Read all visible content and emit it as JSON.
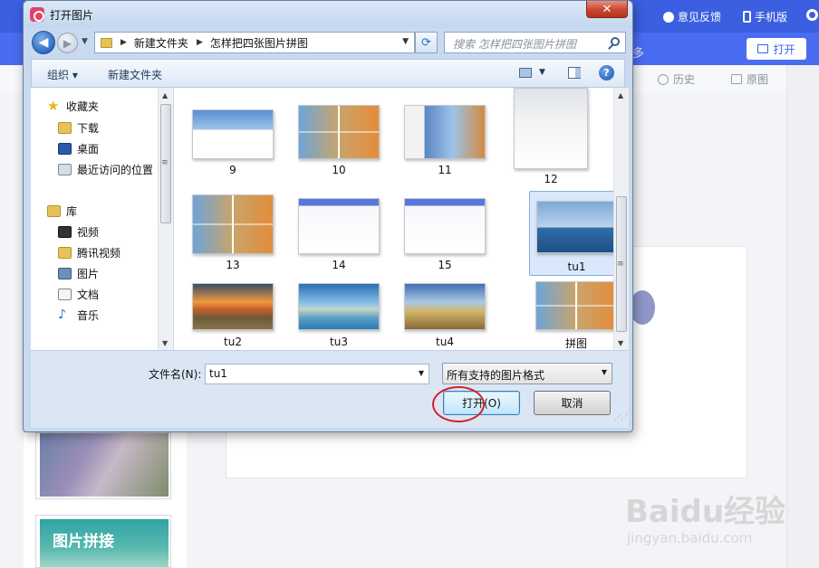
{
  "app": {
    "header": {
      "feedback_label": "意见反馈",
      "mobile_label": "手机版"
    },
    "toolbar": {
      "more_tab": "多",
      "open_button": "打开"
    },
    "subbar": {
      "history_label": "历史",
      "original_label": "原图"
    },
    "left_panel": {
      "collage_card_label": "图片拼接"
    },
    "watermark": {
      "brand": "Baidu经验",
      "url": "jingyan.baidu.com"
    }
  },
  "dialog": {
    "title": "打开图片",
    "close_label": "✕",
    "address_bar": {
      "crumbs": [
        "新建文件夹",
        "怎样把四张图片拼图"
      ]
    },
    "search": {
      "placeholder": "搜索 怎样把四张图片拼图"
    },
    "command_bar": {
      "organize_label": "组织",
      "new_folder_label": "新建文件夹"
    },
    "nav_pane": {
      "favorites_header": "收藏夹",
      "favorites": [
        "下载",
        "桌面",
        "最近访问的位置"
      ],
      "library_header": "库",
      "libraries": [
        "视频",
        "腾讯视频",
        "图片",
        "文档",
        "音乐"
      ]
    },
    "files": [
      {
        "name": "9",
        "thumb": "t-white"
      },
      {
        "name": "10",
        "thumb": "t-collage"
      },
      {
        "name": "11",
        "thumb": "t-menu"
      },
      {
        "name": "12",
        "thumb": "t-dialog"
      },
      {
        "name": "13",
        "thumb": "t-collage"
      },
      {
        "name": "14",
        "thumb": "t-app"
      },
      {
        "name": "15",
        "thumb": "t-app"
      },
      {
        "name": "tu1",
        "thumb": "t-ship",
        "selected": true
      },
      {
        "name": "tu2",
        "thumb": "t-tu2"
      },
      {
        "name": "tu3",
        "thumb": "t-tu3"
      },
      {
        "name": "tu4",
        "thumb": "t-tu4"
      },
      {
        "name": "拼图",
        "thumb": "t-collage"
      }
    ],
    "filename": {
      "label": "文件名(N):",
      "value": "tu1"
    },
    "filetype": {
      "value": "所有支持的图片格式"
    },
    "open_button": "打开(O)",
    "cancel_button": "取消"
  }
}
